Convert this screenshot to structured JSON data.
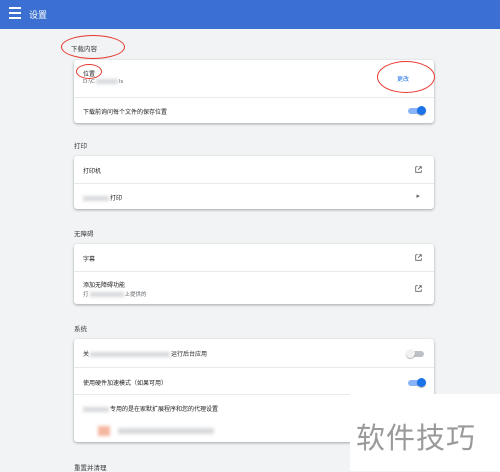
{
  "header": {
    "title": "设置"
  },
  "downloads": {
    "section_title": "下载内容",
    "location_label": "位置",
    "location_path_prefix": "D:\\C",
    "location_path_suffix": "ls",
    "change_button": "更改",
    "ask_label": "下载前询问每个文件的保存位置",
    "ask_toggle_on": true
  },
  "printing": {
    "section_title": "打印",
    "printers_label": "打印机",
    "cloud_print_label": "打印"
  },
  "accessibility": {
    "section_title": "无障碍",
    "captions_label": "字幕",
    "add_features_label": "添加无障碍功能",
    "add_features_sub_prefix": "打",
    "add_features_sub_suffix": "上提供的"
  },
  "system": {
    "section_title": "系统",
    "background_apps_prefix": "关",
    "background_apps_suffix": "运行后台应用",
    "background_apps_on": false,
    "hw_accel_label": "使用硬件加速模式（如果可用）",
    "hw_accel_on": true,
    "proxy_label": "专用的是在家默扩展程序和您的代理设置"
  },
  "reset": {
    "section_title": "重置并清理"
  },
  "watermark": {
    "text": "软件技巧"
  },
  "colors": {
    "accent": "#1a73e8",
    "header": "#3b6fd1",
    "annotation": "#e5392f"
  }
}
